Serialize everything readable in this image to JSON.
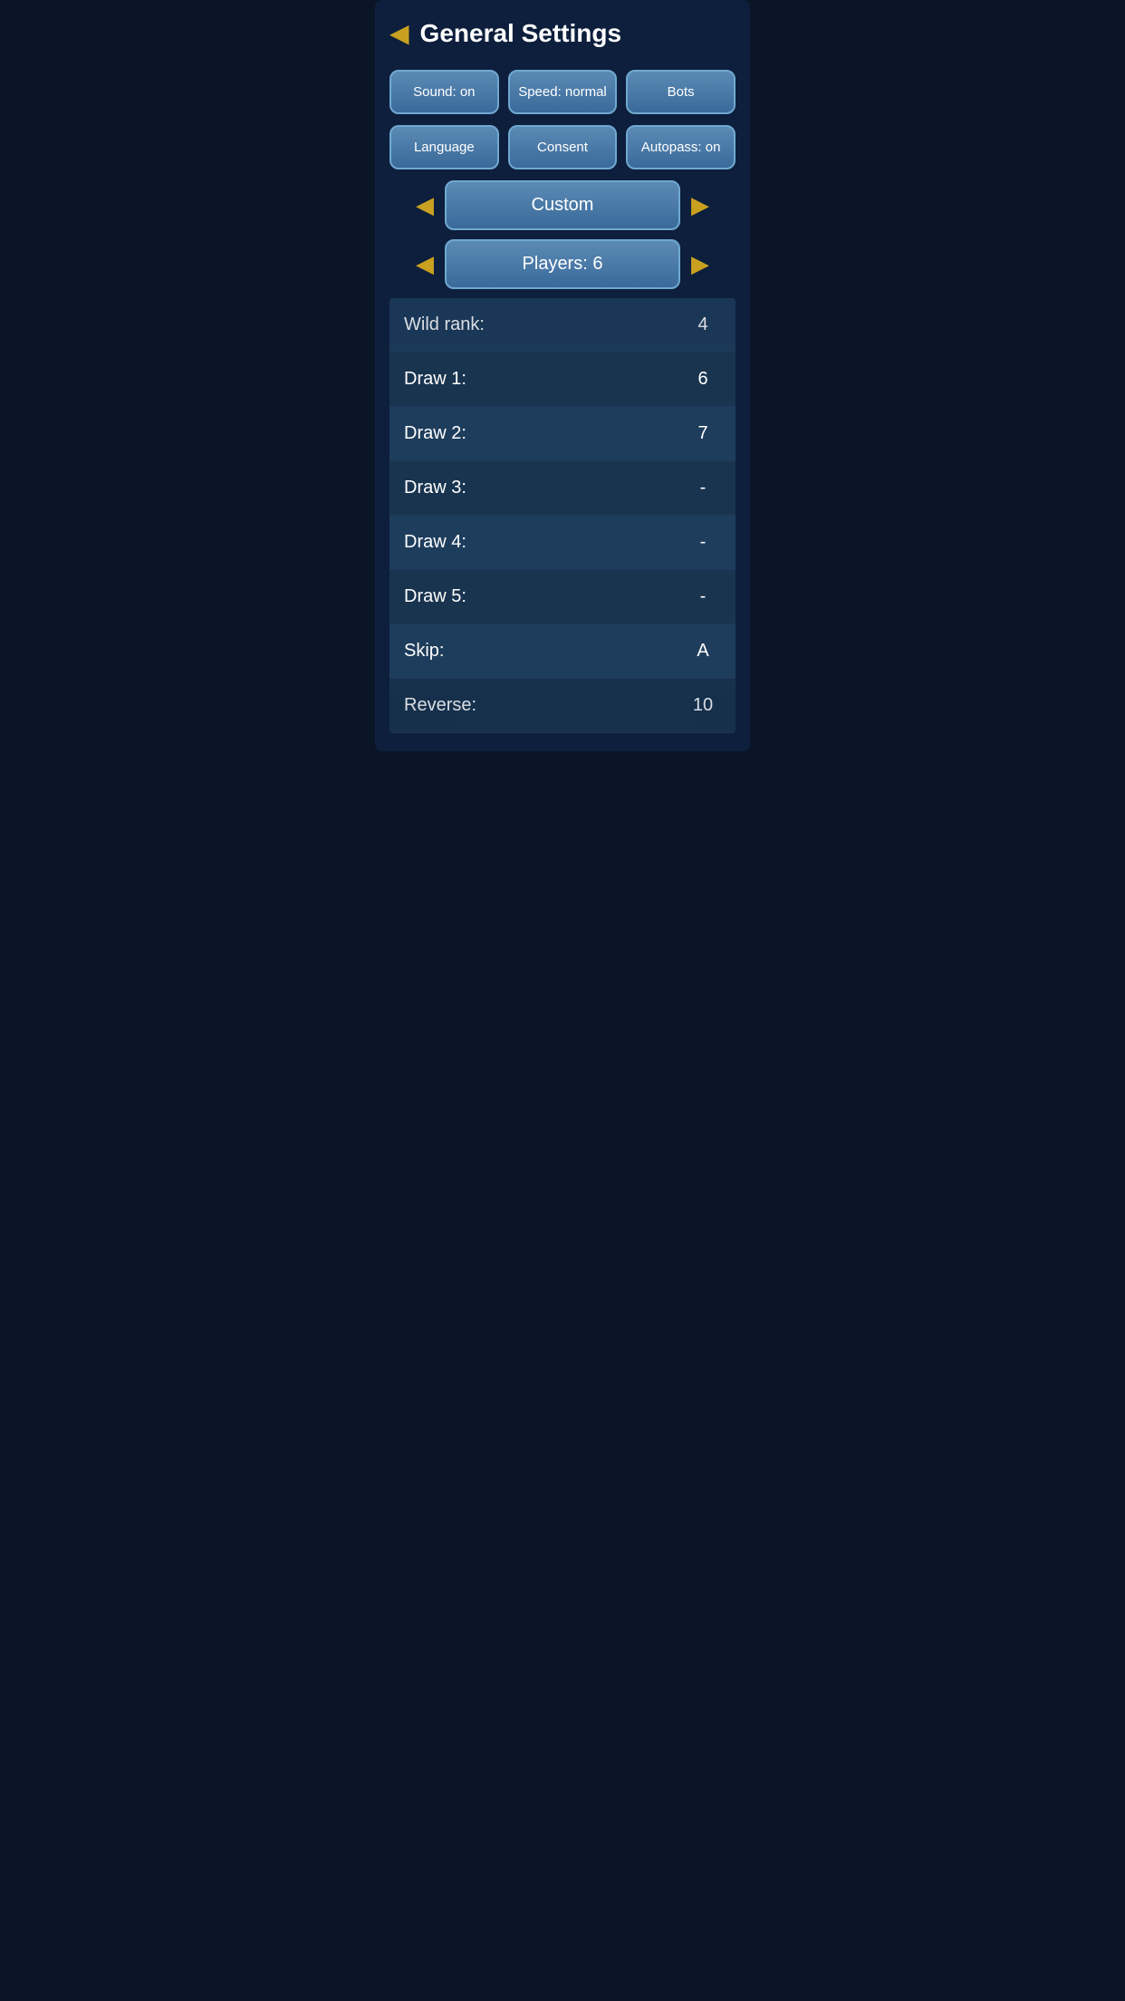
{
  "header": {
    "back_icon": "◀",
    "title": "General Settings"
  },
  "buttons": {
    "row1": [
      {
        "id": "sound-btn",
        "label": "Sound: on"
      },
      {
        "id": "speed-btn",
        "label": "Speed: normal"
      },
      {
        "id": "bots-btn",
        "label": "Bots"
      }
    ],
    "row2": [
      {
        "id": "language-btn",
        "label": "Language"
      },
      {
        "id": "consent-btn",
        "label": "Consent"
      },
      {
        "id": "autopass-btn",
        "label": "Autopass: on"
      }
    ]
  },
  "nav_custom": {
    "left_arrow": "◀",
    "right_arrow": "▶",
    "label": "Custom"
  },
  "nav_players": {
    "left_arrow": "◀",
    "right_arrow": "▶",
    "label": "Players: 6"
  },
  "table_rows": [
    {
      "label": "Wild rank:",
      "value": "4",
      "partial_top": true
    },
    {
      "label": "Draw 1:",
      "value": "6"
    },
    {
      "label": "Draw 2:",
      "value": "7"
    },
    {
      "label": "Draw 3:",
      "value": "-"
    },
    {
      "label": "Draw 4:",
      "value": "-"
    },
    {
      "label": "Draw 5:",
      "value": "-"
    },
    {
      "label": "Skip:",
      "value": "A"
    },
    {
      "label": "Reverse:",
      "value": "10",
      "partial_bottom": true
    }
  ]
}
